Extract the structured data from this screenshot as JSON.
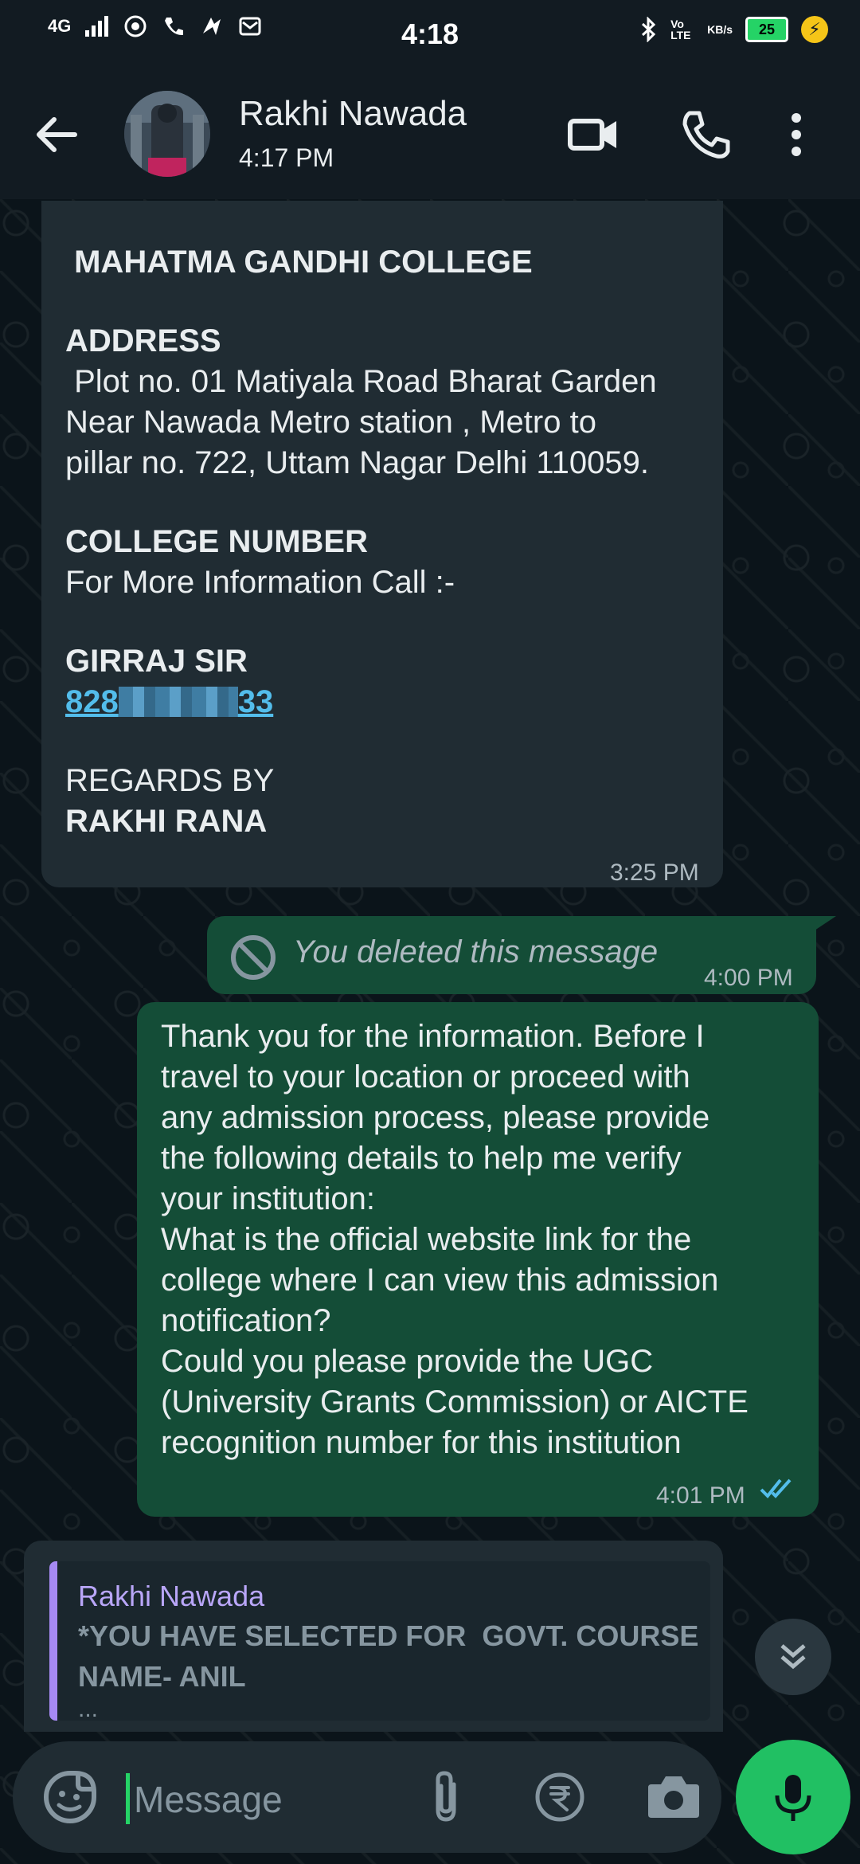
{
  "status_bar": {
    "network": "4G",
    "time": "4:18",
    "volte": "Vo LTE",
    "speed": "KB/s",
    "battery": "25"
  },
  "header": {
    "contact_name": "Rakhi Nawada",
    "last_seen": "4:17 PM"
  },
  "messages": [
    {
      "direction": "incoming",
      "lines": {
        "college": " MAHATMA GANDHI COLLEGE",
        "address_title": "ADDRESS",
        "address_1": " Plot no. 01 Matiyala Road Bharat Garden",
        "address_2": "Near Nawada Metro station , Metro to",
        "address_3": "pillar no. 722, Uttam Nagar Delhi 110059.",
        "number_title": "COLLEGE NUMBER",
        "info": "For More Information Call :-",
        "contact_title": "GIRRAJ SIR",
        "phone_start": "828",
        "phone_end": "33",
        "regards": "REGARDS BY",
        "sender": "RAKHI RANA"
      },
      "time": "3:25 PM"
    },
    {
      "direction": "outgoing",
      "text": "You deleted this message",
      "time": "4:00 PM"
    },
    {
      "direction": "outgoing",
      "lines": [
        "Thank you for the information. Before I",
        "travel to your location or proceed with",
        "any admission process, please provide",
        "the following details to help me verify",
        "your institution:",
        "What is the official website link for the",
        "college where I can view this admission",
        "notification?",
        "Could you please provide the UGC",
        "(University Grants Commission) or AICTE",
        "recognition number for this institution"
      ],
      "time": "4:01 PM",
      "status": "read"
    },
    {
      "direction": "incoming",
      "quoted_name": "Rakhi Nawada",
      "quoted_line_1": "*YOU HAVE SELECTED FOR  GOVT. COURSE",
      "quoted_line_2": "NAME- ANIL",
      "quoted_more": "..."
    }
  ],
  "composer": {
    "placeholder": "Message"
  },
  "colors": {
    "accent": "#21c063",
    "outgoing_bubble": "#144d37",
    "incoming_bubble": "#202c33",
    "link": "#53bdeb"
  }
}
